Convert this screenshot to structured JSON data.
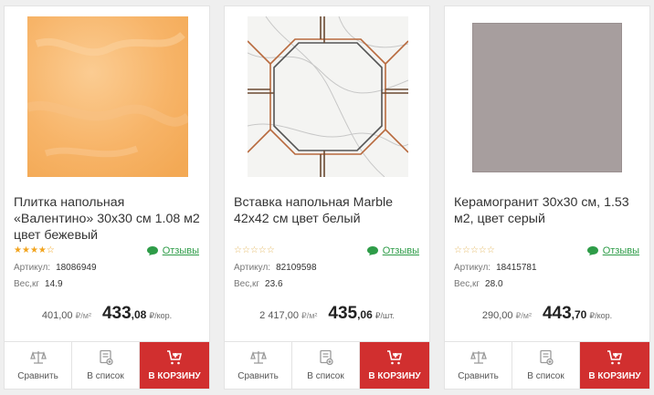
{
  "products": [
    {
      "title": "Плитка напольная «Валентино» 30х30 см 1.08 м2 цвет бежевый",
      "rating": 4,
      "reviews_label": "Отзывы",
      "sku_label": "Артикул:",
      "sku": "18086949",
      "weight_label": "Вес,кг",
      "weight": "14.9",
      "unit_price": "401,00",
      "unit_price_unit": "₽/м²",
      "price_int": "433",
      "price_cents": ",08",
      "price_unit": "₽/кор.",
      "compare_label": "Сравнить",
      "list_label": "В список",
      "cart_label": "В КОРЗИНУ",
      "image_colors": {
        "base": "#f7b46a",
        "light": "#fbc98e"
      }
    },
    {
      "title": "Вставка напольная Marble 42х42 см цвет белый",
      "rating": 0,
      "reviews_label": "Отзывы",
      "sku_label": "Артикул:",
      "sku": "82109598",
      "weight_label": "Вес,кг",
      "weight": "23.6",
      "unit_price": "2 417,00",
      "unit_price_unit": "₽/м²",
      "price_int": "435",
      "price_cents": ",06",
      "price_unit": "₽/шт.",
      "compare_label": "Сравнить",
      "list_label": "В список",
      "cart_label": "В КОРЗИНУ",
      "image_colors": {
        "base": "#f4f4f3",
        "line": "#b86a3e"
      }
    },
    {
      "title": "Керамогранит 30х30 см, 1.53 м2, цвет серый",
      "rating": 0,
      "reviews_label": "Отзывы",
      "sku_label": "Артикул:",
      "sku": "18415781",
      "weight_label": "Вес,кг",
      "weight": "28.0",
      "unit_price": "290,00",
      "unit_price_unit": "₽/м²",
      "price_int": "443",
      "price_cents": ",70",
      "price_unit": "₽/кор.",
      "compare_label": "Сравнить",
      "list_label": "В список",
      "cart_label": "В КОРЗИНУ",
      "image_colors": {
        "base": "#a79e9e"
      }
    }
  ],
  "colors": {
    "accent": "#d12f2f",
    "review_link": "#2e9c48",
    "star": "#f2a41e"
  },
  "icons": {
    "reviews": "speech-bubble-icon",
    "compare": "scales-icon",
    "list": "list-icon",
    "cart": "cart-icon"
  }
}
